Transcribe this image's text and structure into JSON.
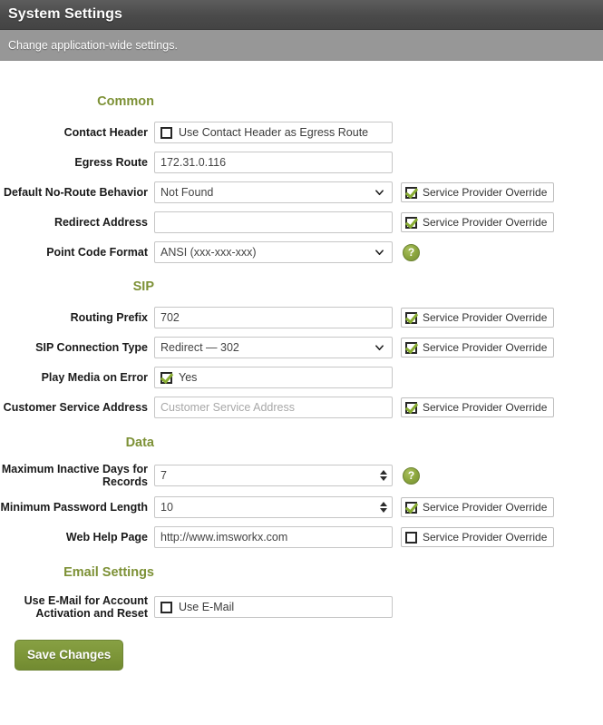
{
  "header": {
    "title": "System Settings",
    "subtitle": "Change application-wide settings."
  },
  "sections": {
    "common": "Common",
    "sip": "SIP",
    "data": "Data",
    "email": "Email Settings"
  },
  "override_label": "Service Provider Override",
  "help_icon_glyph": "?",
  "fields": {
    "contact_header": {
      "label": "Contact Header",
      "checkbox_label": "Use Contact Header as Egress Route",
      "checked": false
    },
    "egress_route": {
      "label": "Egress Route",
      "value": "172.31.0.116"
    },
    "default_no_route_behavior": {
      "label": "Default No-Route Behavior",
      "value": "Not Found",
      "options": [
        "Not Found"
      ],
      "override_checked": true
    },
    "redirect_address": {
      "label": "Redirect Address",
      "value": "",
      "override_checked": true
    },
    "point_code_format": {
      "label": "Point Code Format",
      "value": "ANSI (xxx-xxx-xxx)",
      "options": [
        "ANSI (xxx-xxx-xxx)"
      ],
      "has_help": true
    },
    "routing_prefix": {
      "label": "Routing Prefix",
      "value": "702",
      "override_checked": true
    },
    "sip_connection_type": {
      "label": "SIP Connection Type",
      "value": "Redirect — 302",
      "options": [
        "Redirect — 302"
      ],
      "override_checked": true
    },
    "play_media_on_error": {
      "label": "Play Media on Error",
      "checkbox_label": "Yes",
      "checked": true
    },
    "customer_service_address": {
      "label": "Customer Service Address",
      "placeholder": "Customer Service Address",
      "value": "",
      "override_checked": true
    },
    "maximum_inactive_days": {
      "label": "Maximum Inactive Days for Records",
      "value": "7",
      "has_help": true
    },
    "minimum_password_length": {
      "label": "Minimum Password Length",
      "value": "10",
      "override_checked": true
    },
    "web_help_page": {
      "label": "Web Help Page",
      "value": "http://www.imsworkx.com",
      "override_checked": false
    },
    "use_email": {
      "label": "Use E-Mail for Account Activation and Reset",
      "checkbox_label": "Use E-Mail",
      "checked": false
    }
  },
  "buttons": {
    "save": "Save Changes"
  },
  "colors": {
    "accent_green": "#7d9136",
    "button_green": "#7b9437",
    "header_dark": "#4a4a4a",
    "subheader_gray": "#979797"
  }
}
